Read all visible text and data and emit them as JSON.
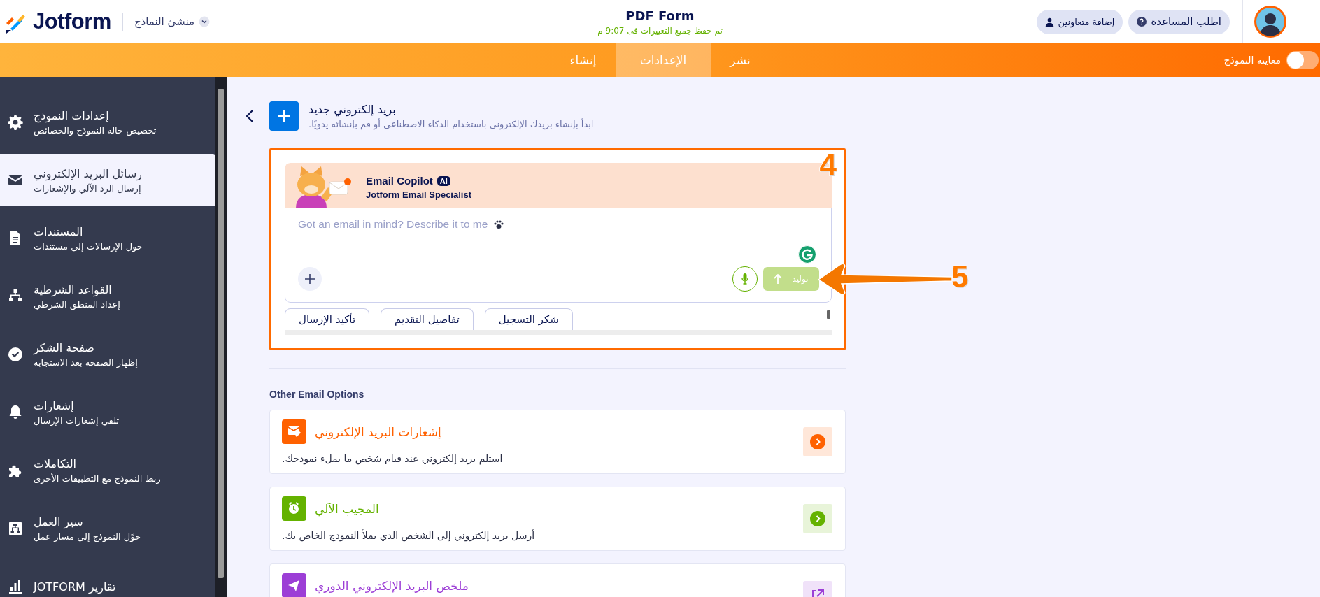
{
  "header": {
    "logo": "Jotform",
    "builder_menu": "منشئ النماذج",
    "form_title": "PDF Form",
    "save_status": "تم حفظ جميع التغييرات فى 9:07 م",
    "buttons": [
      {
        "label": "اطلب المساعدة",
        "kind": "help"
      },
      {
        "label": "إضافة متعاونين",
        "kind": "invite"
      }
    ]
  },
  "nav": {
    "tabs": [
      {
        "label": "نشر",
        "selected": false
      },
      {
        "label": "الإعدادات",
        "selected": true
      },
      {
        "label": "إنشاء",
        "selected": false
      }
    ],
    "preview_toggle": {
      "label": "معاينة النموذج",
      "on": false
    }
  },
  "sidebar": {
    "items": [
      {
        "kind": "settings",
        "title": "إعدادات النموذج",
        "subtitle": "تخصيص حالة النموذج والخصائص",
        "selected": false
      },
      {
        "kind": "emails",
        "title": "رسائل البريد الإلكتروني",
        "subtitle": "إرسال الرد الآلي والإشعارات",
        "selected": true
      },
      {
        "kind": "documents",
        "title": "المستندات",
        "subtitle": "حول الإرسالات إلى مستندات",
        "selected": false
      },
      {
        "kind": "conditions",
        "title": "القواعد الشرطية",
        "subtitle": "إعداد المنطق الشرطي",
        "selected": false
      },
      {
        "kind": "thankyou",
        "title": "صفحة الشكر",
        "subtitle": "إظهار الصفحة بعد الاستجابة",
        "selected": false
      },
      {
        "kind": "notifications",
        "title": "إشعارات",
        "subtitle": "تلقي إشعارات الإرسال",
        "selected": false
      },
      {
        "kind": "integrations",
        "title": "التكاملات",
        "subtitle": "ربط النموذج مع التطبيقات الأخرى",
        "selected": false
      },
      {
        "kind": "workflow",
        "title": "سير العمل",
        "subtitle": "حوّل النموذج إلى مسار عمل",
        "selected": false
      },
      {
        "kind": "reports",
        "title": "تقارير JOTFORM",
        "selected": false
      }
    ]
  },
  "new_email": {
    "title": "بريد إلكتروني جديد",
    "description": "ابدأ بإنشاء بريدك الإلكتروني باستخدام الذكاء الاصطناعي أو قم بإنشائه يدويًا."
  },
  "copilot": {
    "name": "Email Copilot",
    "badge": "AI",
    "role": "Jotform Email Specialist",
    "placeholder": "Got an email in mind? Describe it to me",
    "generate_button": {
      "label": "توليد",
      "disabled": true
    },
    "suggestions": [
      "شكر التسجيل",
      "تفاصيل التقديم",
      "تأكيد الإرسال"
    ]
  },
  "annotations": [
    {
      "label": "4"
    },
    {
      "label": "5"
    }
  ],
  "other_options": {
    "heading": "Other Email Options",
    "items": [
      {
        "kind": "notification",
        "title": "إشعارات البريد الإلكتروني",
        "description": "استلم بريد إلكتروني عند قيام شخص ما بملء نموذجك.",
        "color": "#ff6100"
      },
      {
        "kind": "autoresponder",
        "title": "المجيب الآلي",
        "description": "أرسل بريد إلكتروني إلى الشخص الذي يملأ النموذج الخاص بك.",
        "color": "#64b200"
      },
      {
        "kind": "digest",
        "title": "ملخص البريد الإلكتروني الدوري",
        "color": "#9c3ed6"
      }
    ]
  }
}
